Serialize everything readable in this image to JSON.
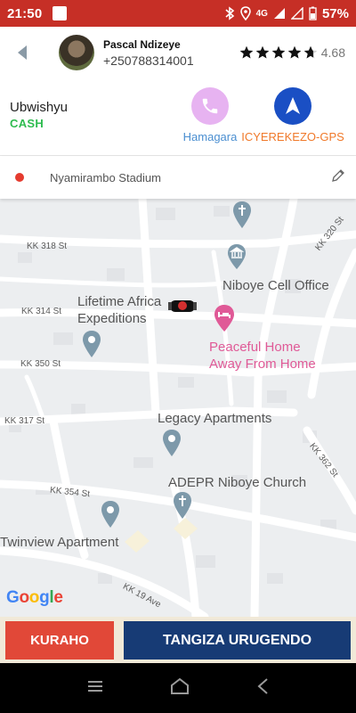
{
  "status_bar": {
    "time": "21:50",
    "network": "4G",
    "battery": "57%",
    "background_color": "#c62f26"
  },
  "driver": {
    "name": "Pascal Ndizeye",
    "phone": "+250788314001",
    "rating_value": "4.68",
    "rating": 4.68,
    "rating_max": 5
  },
  "payment": {
    "label": "Ubwishyu",
    "method": "CASH",
    "method_color": "#2ebc4f"
  },
  "actions": {
    "call_label": "Hamagara",
    "gps_label": "ICYEREKEZO-GPS",
    "call_icon": "phone-icon",
    "gps_icon": "navigation-arrow-icon"
  },
  "destination": {
    "name": "Nyamirambo Stadium"
  },
  "map": {
    "streets": {
      "kk318": "KK 318 St",
      "kk314": "KK 314 St",
      "kk350": "KK 350 St",
      "kk317": "KK 317 St",
      "kk354": "KK 354 St",
      "kk320": "KK 320 St",
      "kk362": "KK 362 St",
      "kk19": "KK 19 Ave"
    },
    "places": {
      "lifetime_line1": "Lifetime Africa",
      "lifetime_line2": "Expeditions",
      "niboye_cell": "Niboye Cell Office",
      "peaceful_line1": "Peaceful Home",
      "peaceful_line2": "Away From Home",
      "legacy": "Legacy Apartments",
      "adepr": "ADEPR Niboye Church",
      "twinview": "Twinview Apartment"
    },
    "google_logo": "Google"
  },
  "buttons": {
    "cancel": "KURAHO",
    "start": "TANGIZA URUGENDO"
  }
}
